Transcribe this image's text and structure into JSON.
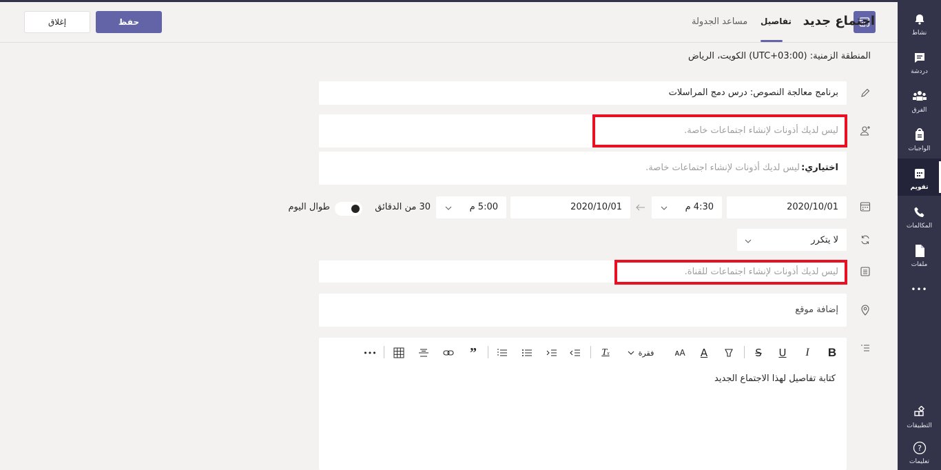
{
  "rail": {
    "items": [
      {
        "label": "نشاط",
        "icon": "bell-icon"
      },
      {
        "label": "دردشة",
        "icon": "chat-icon"
      },
      {
        "label": "الفرق",
        "icon": "teams-icon"
      },
      {
        "label": "الواجبات",
        "icon": "assignments-icon"
      },
      {
        "label": "تقويم",
        "icon": "calendar-icon",
        "active": true
      },
      {
        "label": "المكالمات",
        "icon": "phone-icon"
      },
      {
        "label": "ملفات",
        "icon": "files-icon"
      }
    ],
    "more": "•••",
    "apps_label": "التطبيقات",
    "help_label": "تعليمات"
  },
  "header": {
    "title": "اجتماع جديد",
    "tab_details": "تفاصيل",
    "tab_assistant": "مساعد الجدولة",
    "save_label": "حفظ",
    "close_label": "إغلاق"
  },
  "timezone": "المنطقة الزمنية: (UTC+03:00) الكويت، الرياض",
  "form": {
    "title_value": "برنامج معالجة النصوص: درس دمج المراسلات",
    "attendees_placeholder": "ليس لديك أذونات لإنشاء اجتماعات خاصة.",
    "optional_label": "اختياري:",
    "optional_placeholder": "ليس لديك أذونات لإنشاء اجتماعات خاصة.",
    "start_date": "2020/10/01",
    "start_time": "4:30 م",
    "end_date": "2020/10/01",
    "end_time": "5:00 م",
    "duration": "30 من الدقائق",
    "all_day_label": "طوال اليوم",
    "repeat_value": "لا يتكرر",
    "channel_placeholder": "ليس لديك أذونات لإنشاء اجتماعات للقناة.",
    "location_placeholder": "إضافة موقع",
    "details_placeholder": "كتابة تفاصيل لهذا الاجتماع الجديد",
    "paragraph_label": "فقرة"
  },
  "colors": {
    "accent": "#6264a7",
    "rail": "#33344a",
    "highlight": "#e81123"
  }
}
